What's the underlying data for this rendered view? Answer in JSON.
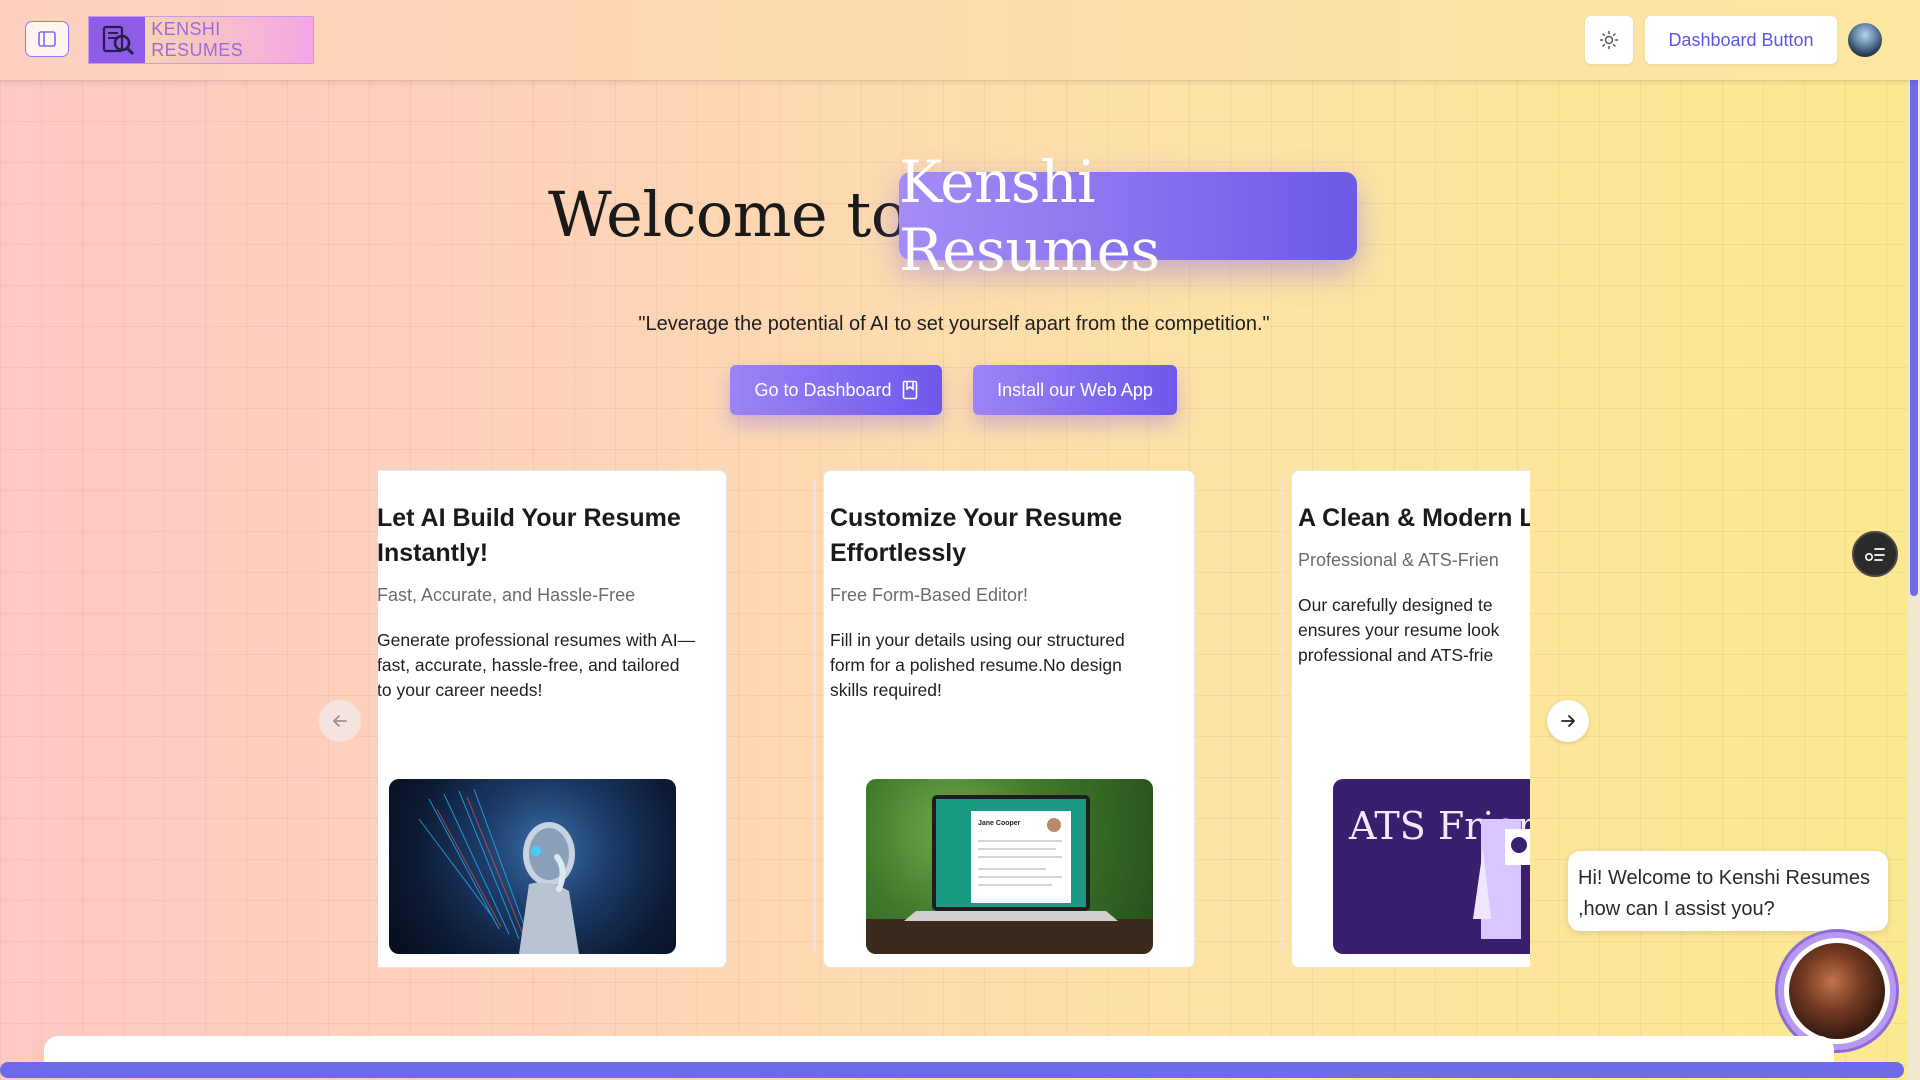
{
  "header": {
    "sidebar_toggle_icon": "sidebar-panel-icon",
    "logo_text": "KENSHI RESUMES",
    "logo_icon": "resume-search-icon",
    "theme_icon": "sun-icon",
    "dashboard_button": "Dashboard Button",
    "avatar_icon": "user-avatar"
  },
  "hero": {
    "welcome": "Welcome to",
    "brand": "Kenshi Resumes",
    "tagline": "\"Leverage the potential of AI to set yourself apart from the competition.\"",
    "cta_dashboard": "Go to Dashboard",
    "cta_dashboard_icon": "bookmark-icon",
    "cta_install": "Install our Web App"
  },
  "cards": [
    {
      "title": "Let AI Build Your Resume Instantly!",
      "subtitle": "Fast, Accurate, and Hassle-Free",
      "description": "Generate professional resumes with AI—fast, accurate, hassle-free, and tailored to your career needs!"
    },
    {
      "title": "Customize Your Resume Effortlessly",
      "subtitle": "Free Form-Based Editor!",
      "description": "Fill in your details using our structured form for a polished resume.No design skills required!",
      "image_name_text": "Jane Cooper"
    },
    {
      "title": "A Clean & Modern Layout",
      "subtitle": "Professional & ATS-Frien",
      "description": "Our carefully designed te ensures your resume look professional and ATS-frie",
      "image_text": "ATS Friendly CV"
    }
  ],
  "carousel": {
    "prev_icon": "arrow-left-icon",
    "next_icon": "arrow-right-icon"
  },
  "floating": {
    "fab_icon": "menu-list-icon",
    "chat_message": "Hi! Welcome to Kenshi Resumes ,how can I assist you?"
  },
  "colors": {
    "accent": "#6e58ea",
    "accent_light": "#a58cf7",
    "bottom_bar": "#6f6ae8"
  }
}
